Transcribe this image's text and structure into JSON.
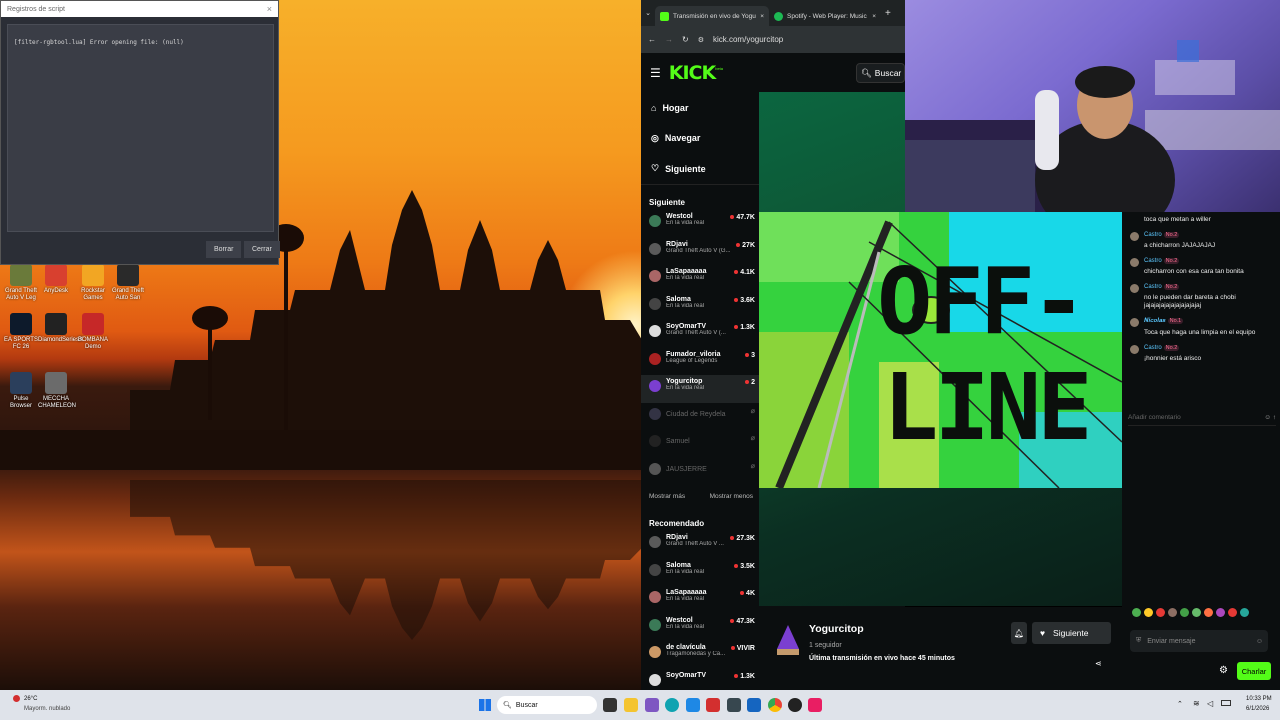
{
  "log_window": {
    "title": "Registros de script",
    "close": "×",
    "log_text": "[filter-rgbtool.lua] Error opening file: (null)",
    "clear_label": "Borrar",
    "close_label": "Cerrar"
  },
  "desktop_icons": [
    {
      "label": "Grand Theft Auto V Leg",
      "color": "#6a7a3a"
    },
    {
      "label": "AnyDesk",
      "color": "#d8402f"
    },
    {
      "label": "Rockstar Games",
      "color": "#f2a623"
    },
    {
      "label": "Grand Theft Auto San",
      "color": "#2a2a2a"
    },
    {
      "label": "EA SPORTS FC 26",
      "color": "#0d1a2b"
    },
    {
      "label": "DiamondSeriesX",
      "color": "#222"
    },
    {
      "label": "BOMBANA Demo",
      "color": "#c62828"
    },
    {
      "label": "Pulse Browser",
      "color": "#2b3f5c"
    },
    {
      "label": "MECCHA CHAMELEON",
      "color": "#6b6b6b"
    }
  ],
  "browser": {
    "tabs": [
      {
        "label": "Transmisión en vivo de Yogurc",
        "fav_color": "#53fc18",
        "active": true
      },
      {
        "label": "Spotify - Web Player: Music fo",
        "fav_color": "#1db954",
        "active": false
      }
    ],
    "tab_close": "×",
    "new_tab": "+",
    "url": "kick.com/yogurcitop"
  },
  "kick": {
    "logo": "KICK",
    "logo_badge": "beta",
    "search_label": "Buscar",
    "nav": [
      {
        "label": "Hogar",
        "icon": "home-icon"
      },
      {
        "label": "Navegar",
        "icon": "compass-icon"
      },
      {
        "label": "Siguiente",
        "icon": "heart-icon"
      }
    ],
    "following_title": "Siguiente",
    "following": [
      {
        "name": "Westcol",
        "category": "En la vida real",
        "viewers": "47.7K",
        "avatar": "#3b7a57"
      },
      {
        "name": "RDjavi",
        "category": "Grand Theft Auto V (G...",
        "viewers": "27K",
        "avatar": "#5a5a5a"
      },
      {
        "name": "LaSapaaaaa",
        "category": "En la vida real",
        "viewers": "4.1K",
        "avatar": "#a66"
      },
      {
        "name": "Saloma",
        "category": "En la vida real",
        "viewers": "3.6K",
        "avatar": "#444"
      },
      {
        "name": "SoyOmarTV",
        "category": "Grand Theft Auto V (...",
        "viewers": "1.3K",
        "avatar": "#ddd"
      },
      {
        "name": "Fumador_viloria",
        "category": "League of Legends",
        "viewers": "3",
        "avatar": "#a22"
      },
      {
        "name": "Yogurcitop",
        "category": "En la vida real",
        "viewers": "2",
        "avatar": "#7b3fd0"
      }
    ],
    "following_offline": [
      {
        "name": "Ciudad de Reydela",
        "avatar": "#334"
      },
      {
        "name": "Samuel",
        "avatar": "#222"
      },
      {
        "name": "JAUSJERRE",
        "avatar": "#555"
      }
    ],
    "show_more": "Mostrar más",
    "show_less": "Mostrar menos",
    "recommended_title": "Recomendado",
    "recommended": [
      {
        "name": "RDjavi",
        "category": "Grand Theft Auto V ...",
        "viewers": "27.3K",
        "avatar": "#5a5a5a"
      },
      {
        "name": "Saloma",
        "category": "En la vida real",
        "viewers": "3.5K",
        "avatar": "#444"
      },
      {
        "name": "LaSapaaaaa",
        "category": "En la vida real",
        "viewers": "4K",
        "avatar": "#a66"
      },
      {
        "name": "Westcol",
        "category": "En la vida real",
        "viewers": "47.3K",
        "avatar": "#3b7a57"
      },
      {
        "name": "de clavícula",
        "category": "Tragamonedas y Ca...",
        "viewers": "VIVIR",
        "avatar": "#c96"
      },
      {
        "name": "SoyOmarTV",
        "category": "",
        "viewers": "1.3K",
        "avatar": "#ddd"
      }
    ]
  },
  "stream": {
    "offline_line1": "OFF-",
    "offline_line2": "LINE"
  },
  "channel": {
    "name": "Yogurcitop",
    "followers": "1 seguidor",
    "last_stream": "Última transmisión en vivo hace 45 minutos",
    "follow_label": "Siguiente"
  },
  "chat": {
    "messages": [
      {
        "user": "",
        "badge": "",
        "text": "toca que metan a willer"
      },
      {
        "user": "Castro",
        "badge": "No.2",
        "text": "a chicharron JAJAJAJAJ"
      },
      {
        "user": "Castro",
        "badge": "No.2",
        "text": "chicharron con esa cara tan bonita"
      },
      {
        "user": "Castro",
        "badge": "No.2",
        "text": "no le pueden dar bareta a chobi jajajajajajajajajajajaj"
      },
      {
        "user": "𝑵𝒊𝒄𝒐𝒍𝒂𝒔",
        "badge": "No.1",
        "text": "Toca que haga una limpia en el equipo"
      },
      {
        "user": "Castro",
        "badge": "No.2",
        "text": "¡honnier está arisco"
      }
    ],
    "comment_placeholder": "Añadir comentario",
    "input_placeholder": "Enviar mensaje",
    "send_label": "Charlar"
  },
  "taskbar": {
    "weather_temp": "26°C",
    "weather_desc": "Mayorm. nublado",
    "search_label": "Buscar",
    "time": "10:33 PM",
    "date": "6/1/2026"
  }
}
